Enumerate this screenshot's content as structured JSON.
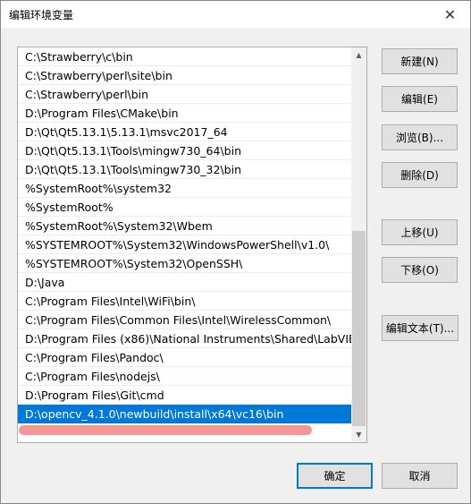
{
  "window": {
    "title": "编辑环境变量",
    "close_glyph": "✕"
  },
  "list": {
    "items": [
      "C:\\Strawberry\\c\\bin",
      "C:\\Strawberry\\perl\\site\\bin",
      "C:\\Strawberry\\perl\\bin",
      "D:\\Program Files\\CMake\\bin",
      "D:\\Qt\\Qt5.13.1\\5.13.1\\msvc2017_64",
      "D:\\Qt\\Qt5.13.1\\Tools\\mingw730_64\\bin",
      "D:\\Qt\\Qt5.13.1\\Tools\\mingw730_32\\bin",
      "%SystemRoot%\\system32",
      "%SystemRoot%",
      "%SystemRoot%\\System32\\Wbem",
      "%SYSTEMROOT%\\System32\\WindowsPowerShell\\v1.0\\",
      "%SYSTEMROOT%\\System32\\OpenSSH\\",
      "D:\\Java",
      "C:\\Program Files\\Intel\\WiFi\\bin\\",
      "C:\\Program Files\\Common Files\\Intel\\WirelessCommon\\",
      "D:\\Program Files (x86)\\National Instruments\\Shared\\LabVIE...",
      "C:\\Program Files\\Pandoc\\",
      "C:\\Program Files\\nodejs\\",
      "D:\\Program Files\\Git\\cmd",
      "D:\\opencv_4.1.0\\newbuild\\install\\x64\\vc16\\bin"
    ],
    "selected_index": 19,
    "scroll_up_glyph": "▲",
    "scroll_down_glyph": "▼"
  },
  "buttons": {
    "new": "新建(N)",
    "edit": "编辑(E)",
    "browse": "浏览(B)...",
    "delete": "删除(D)",
    "move_up": "上移(U)",
    "move_down": "下移(O)",
    "edit_text": "编辑文本(T)...",
    "ok": "确定",
    "cancel": "取消"
  },
  "colors": {
    "selection": "#0078d7",
    "annotation_mark": "#f48c8c"
  }
}
